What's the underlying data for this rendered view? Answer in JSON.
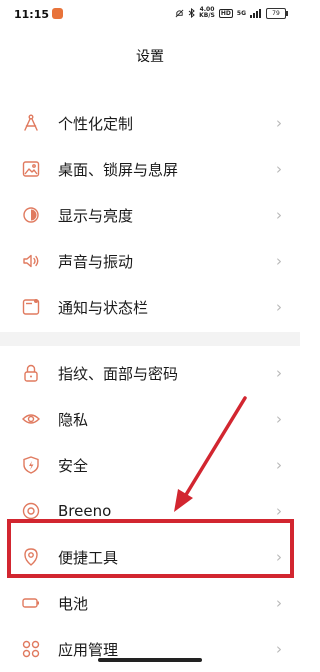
{
  "status": {
    "time": "11:15",
    "speed_value": "4.00",
    "speed_unit": "KB/S",
    "hd_label": "HD",
    "signal": "5G",
    "battery": "79"
  },
  "header": {
    "title": "设置"
  },
  "groups": [
    {
      "items": [
        {
          "label": "个性化定制",
          "icon": "compass-icon"
        },
        {
          "label": "桌面、锁屏与息屏",
          "icon": "wallpaper-icon"
        },
        {
          "label": "显示与亮度",
          "icon": "brightness-icon"
        },
        {
          "label": "声音与振动",
          "icon": "speaker-icon"
        },
        {
          "label": "通知与状态栏",
          "icon": "notification-icon"
        }
      ]
    },
    {
      "items": [
        {
          "label": "指纹、面部与密码",
          "icon": "lock-icon"
        },
        {
          "label": "隐私",
          "icon": "eye-icon"
        },
        {
          "label": "安全",
          "icon": "shield-icon"
        },
        {
          "label": "Breeno",
          "icon": "breeno-icon"
        },
        {
          "label": "便捷工具",
          "icon": "tools-icon"
        },
        {
          "label": "电池",
          "icon": "battery-icon"
        },
        {
          "label": "应用管理",
          "icon": "apps-icon"
        }
      ]
    }
  ],
  "chevron": "›",
  "colors": {
    "icon_accent": "#e07a5f",
    "annotation": "#d22630"
  }
}
